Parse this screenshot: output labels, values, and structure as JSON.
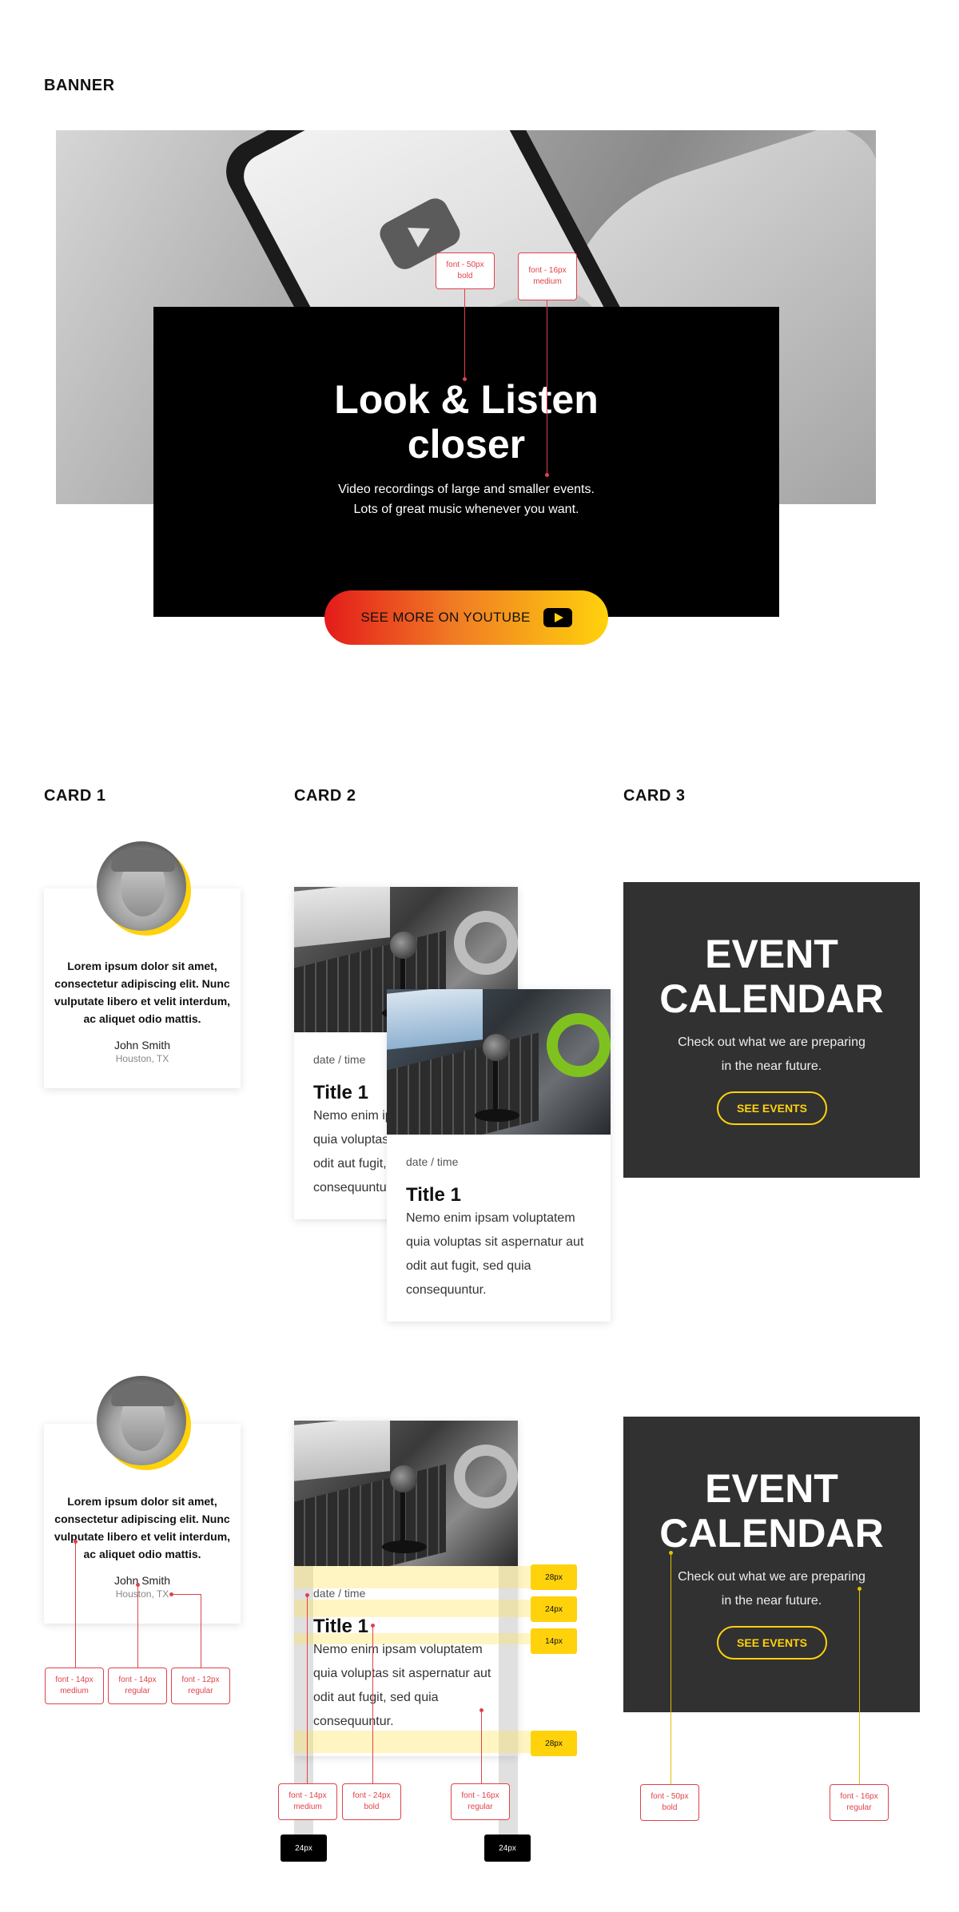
{
  "banner": {
    "section_label": "BANNER",
    "title_line1": "Look & Listen",
    "title_line2": "closer",
    "subtitle_line1": "Video recordings of large and smaller events.",
    "subtitle_line2": "Lots of great music whenever you want.",
    "button_label": "SEE MORE ON YOUTUBE",
    "annotations": {
      "title_font_line1": "font - 50px",
      "title_font_line2": "bold",
      "sub_font_line1": "font - 16px",
      "sub_font_line2": "medium"
    }
  },
  "card1": {
    "section_label": "CARD 1",
    "quote": "Lorem ipsum dolor sit amet, consectetur adipiscing elit. Nunc vulputate libero et velit interdum, ac aliquet odio mattis.",
    "name": "John Smith",
    "location": "Houston, TX",
    "annotations": [
      {
        "line1": "font - 14px",
        "line2": "medium"
      },
      {
        "line1": "font - 14px",
        "line2": "regular"
      },
      {
        "line1": "font - 12px",
        "line2": "regular"
      }
    ]
  },
  "card2": {
    "section_label": "CARD 2",
    "date": "date / time",
    "title": "Title 1",
    "body": "Nemo enim ipsam voluptatem quia voluptas sit aspernatur aut odit aut fugit, sed quia consequuntur.",
    "spacing_tags": [
      "28px",
      "24px",
      "14px",
      "28px"
    ],
    "gutter_tags": [
      "24px",
      "24px"
    ],
    "annotations": [
      {
        "line1": "font - 14px",
        "line2": "medium"
      },
      {
        "line1": "font - 24px",
        "line2": "bold"
      },
      {
        "line1": "font - 16px",
        "line2": "regular"
      }
    ]
  },
  "card3": {
    "section_label": "CARD 3",
    "title_line1": "EVENT",
    "title_line2": "CALENDAR",
    "subtitle": "Check out what we are preparing in the near future.",
    "button_label": "SEE EVENTS",
    "annotations": [
      {
        "line1": "font - 50px",
        "line2": "bold"
      },
      {
        "line1": "font - 16px",
        "line2": "regular"
      }
    ]
  },
  "colors": {
    "accent_yellow": "#ffd20c",
    "accent_red": "#e41b1b",
    "annotation_red": "#e0424a",
    "card_dark": "#313131"
  }
}
